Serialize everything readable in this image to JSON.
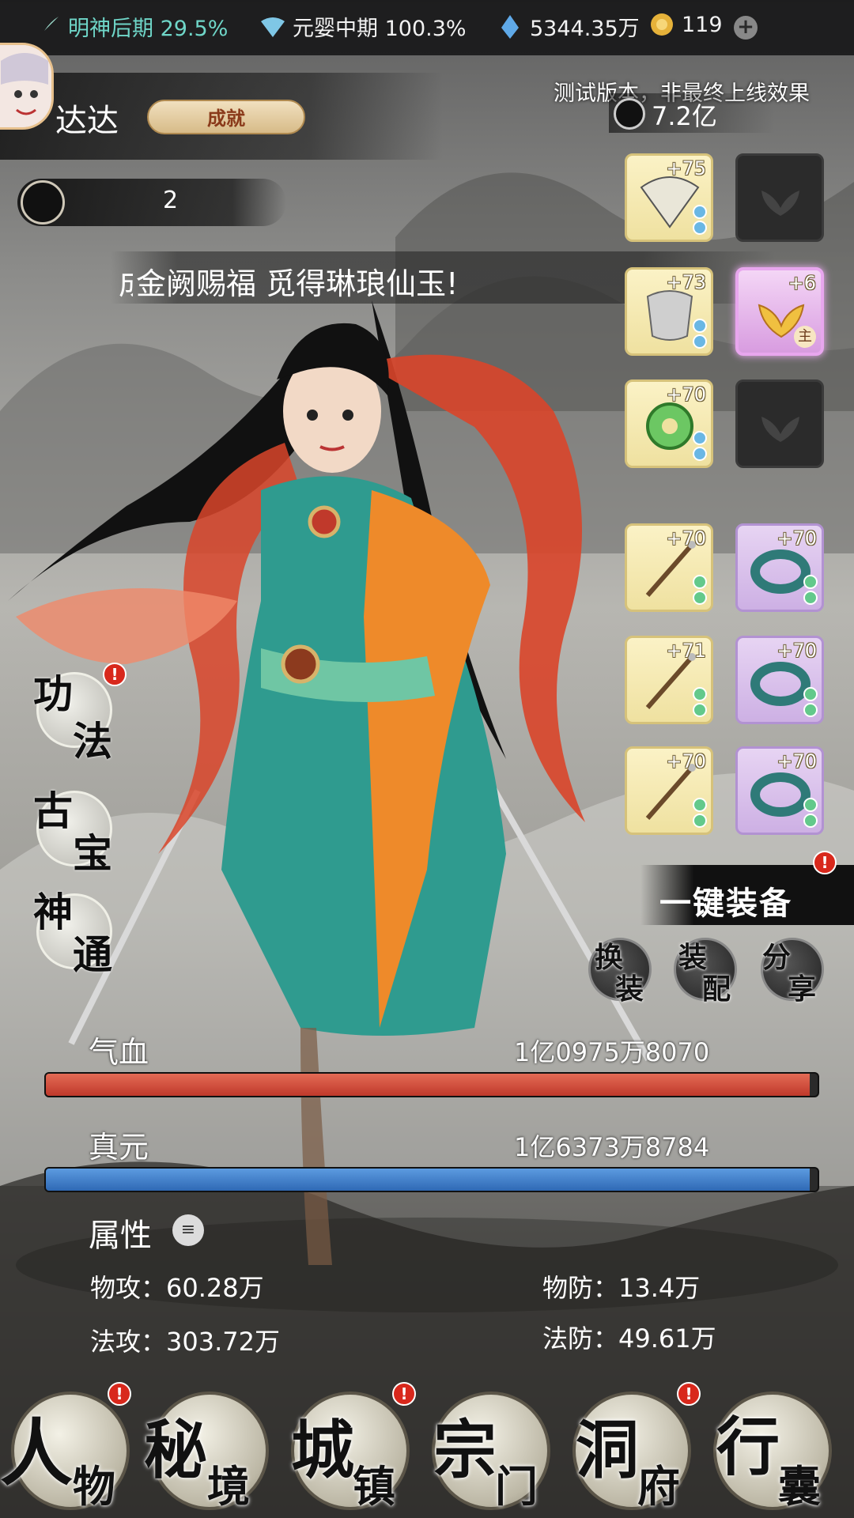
{
  "top_bar": {
    "cultivation_stage": "明神后期 29.5%",
    "secondary_stage": "元婴中期 100.3%",
    "spirit_stones": "5344.35万",
    "gold": "119",
    "plus_icon": "plus-icon"
  },
  "player": {
    "name": "达达",
    "achievement_label": "成就",
    "power": "7.2亿",
    "rank": "2",
    "test_notice": "测试版本，非最终上线效果"
  },
  "news": {
    "prefix": "成",
    "text": "金阙赐福 觅得琳琅仙玉!"
  },
  "equipment": {
    "slots": [
      {
        "level": "+75"
      },
      {
        "level": ""
      },
      {
        "level": "+73"
      },
      {
        "level": "+6",
        "tag": "主"
      },
      {
        "level": "+70"
      },
      {
        "level": ""
      },
      {
        "level": "+70"
      },
      {
        "level": "+70"
      },
      {
        "level": "+71"
      },
      {
        "level": "+70"
      },
      {
        "level": "+70"
      },
      {
        "level": "+70"
      }
    ],
    "equip_all_label": "一键装备",
    "swap_label_1": "换",
    "swap_label_2": "装",
    "match_label_1": "装",
    "match_label_2": "配",
    "share_label_1": "分",
    "share_label_2": "享"
  },
  "side_menu": {
    "skills_1": "功",
    "skills_2": "法",
    "treasure_1": "古",
    "treasure_2": "宝",
    "divine_1": "神",
    "divine_2": "通",
    "badge": "!"
  },
  "stats": {
    "hp_label": "气血",
    "hp_value": "1亿0975万8070",
    "hp_fraction": 0.99,
    "mp_label": "真元",
    "mp_value": "1亿6373万8784",
    "mp_fraction": 0.99,
    "attr_title": "属性",
    "phys_atk": "物攻：60.28万",
    "phys_def": "物防：13.4万",
    "magic_atk": "法攻：303.72万",
    "magic_def": "法防：49.61万"
  },
  "bottom_nav": [
    {
      "a": "人",
      "b": "物"
    },
    {
      "a": "秘",
      "b": "境"
    },
    {
      "a": "城",
      "b": "镇"
    },
    {
      "a": "宗",
      "b": "门"
    },
    {
      "a": "洞",
      "b": "府"
    },
    {
      "a": "行",
      "b": "囊"
    }
  ],
  "colors": {
    "hp_bar": "#c0392b",
    "mp_bar": "#2f69b5",
    "cultivation_text": "#6fd6c8",
    "badge_red": "#d8281c"
  }
}
